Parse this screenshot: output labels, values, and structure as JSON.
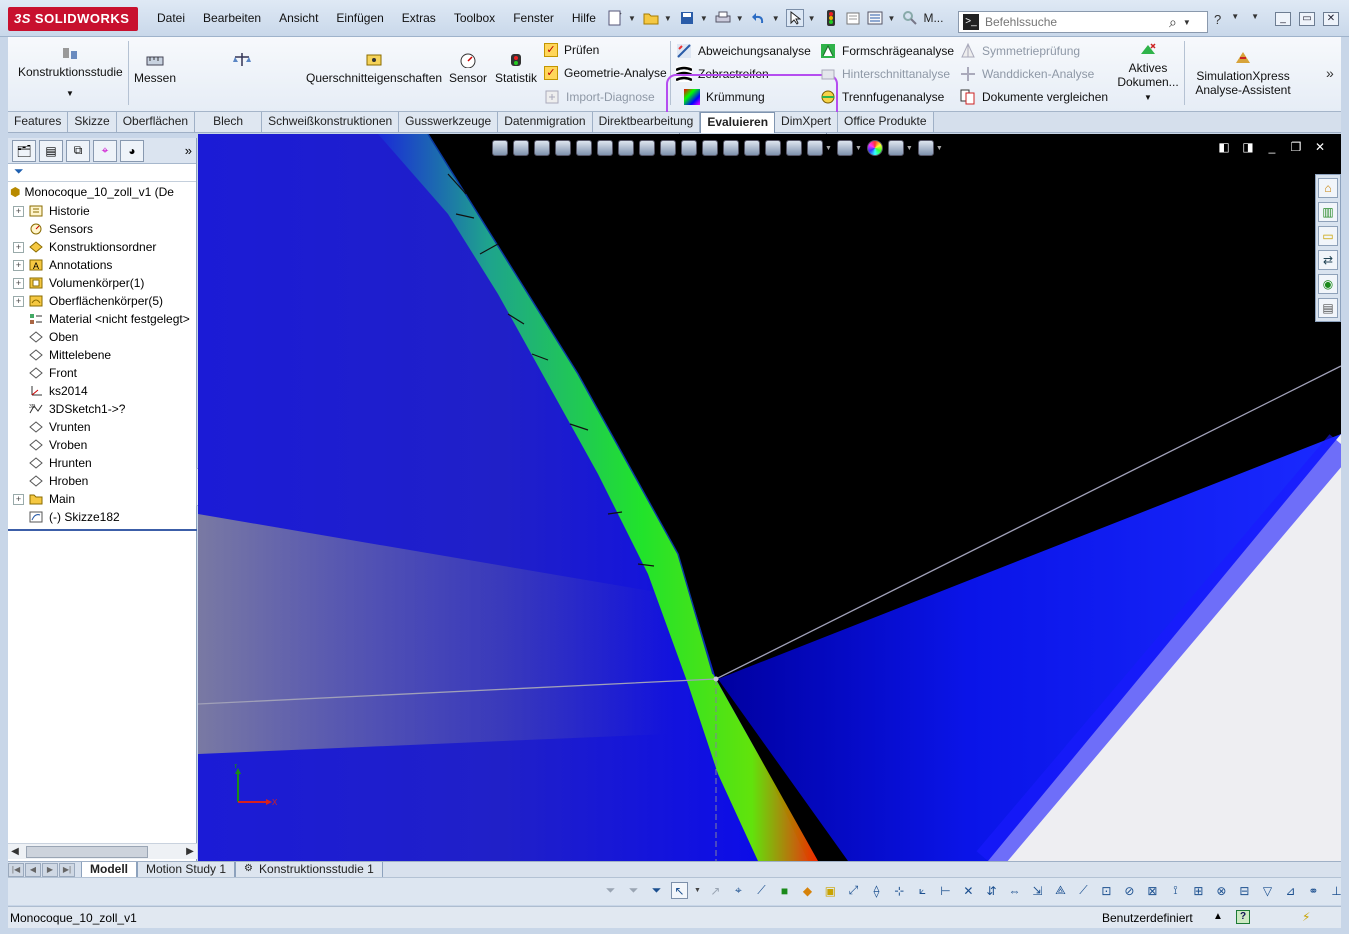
{
  "app": {
    "brand": "SOLIDWORKS",
    "brand_prefix": "3S"
  },
  "menu": {
    "items": [
      "Datei",
      "Bearbeiten",
      "Ansicht",
      "Einfügen",
      "Extras",
      "Toolbox",
      "Fenster",
      "Hilfe"
    ]
  },
  "quickaccess": {
    "m_label": "M..."
  },
  "search": {
    "placeholder": "Befehlssuche"
  },
  "ribbon": {
    "konstruktionsstudie": "Konstruktionsstudie",
    "messen": "Messen",
    "masseeigenschaften": "Masseneigenschaften",
    "querschnitt": "Querschnitteigenschaften",
    "sensor": "Sensor",
    "statistik": "Statistik",
    "pruefen": "Prüfen",
    "geometrie": "Geometrie-Analyse",
    "import": "Import-Diagnose",
    "abweichung": "Abweichungsanalyse",
    "zebra": "Zebrastreifen",
    "kruemmung": "Krümmung",
    "formschraege": "Formschrägeanalyse",
    "hinterschnitt": "Hinterschnittanalyse",
    "trennfugen": "Trennfugenanalyse",
    "symmetrie": "Symmetrieprüfung",
    "wanddicken": "Wanddicken-Analyse",
    "dokumente": "Dokumente vergleichen",
    "aktives_line1": "Aktives",
    "aktives_line2": "Dokumen...",
    "simxpress_line1": "SimulationXpress",
    "simxpress_line2": "Analyse-Assistent"
  },
  "tabs": {
    "items": [
      "Features",
      "Skizze",
      "Oberflächen",
      "Blech",
      "Schweißkonstruktionen",
      "Gusswerkzeuge",
      "Datenmigration",
      "Direktbearbeitung",
      "Evaluieren",
      "DimXpert",
      "Office Produkte"
    ],
    "active": "Evaluieren"
  },
  "tree": {
    "root": "Monocoque_10_zoll_v1  (De",
    "items": [
      {
        "label": "Historie",
        "icon": "history-icon",
        "expandable": true
      },
      {
        "label": "Sensors",
        "icon": "sensor-icon",
        "expandable": false
      },
      {
        "label": "Konstruktionsordner",
        "icon": "design-binder-icon",
        "expandable": true
      },
      {
        "label": "Annotations",
        "icon": "annotations-icon",
        "expandable": true
      },
      {
        "label": "Volumenkörper(1)",
        "icon": "solid-bodies-icon",
        "expandable": true
      },
      {
        "label": "Oberflächenkörper(5)",
        "icon": "surface-bodies-icon",
        "expandable": true
      },
      {
        "label": "Material <nicht festgelegt>",
        "icon": "material-icon",
        "expandable": false
      },
      {
        "label": "Oben",
        "icon": "plane-icon",
        "expandable": false
      },
      {
        "label": "Mittelebene",
        "icon": "plane-icon",
        "expandable": false
      },
      {
        "label": "Front",
        "icon": "plane-icon",
        "expandable": false
      },
      {
        "label": "ks2014",
        "icon": "coordinate-system-icon",
        "expandable": false
      },
      {
        "label": "3DSketch1->?",
        "icon": "3d-sketch-icon",
        "expandable": false
      },
      {
        "label": "Vrunten",
        "icon": "plane-icon",
        "expandable": false
      },
      {
        "label": "Vroben",
        "icon": "plane-icon",
        "expandable": false
      },
      {
        "label": "Hrunten",
        "icon": "plane-icon",
        "expandable": false
      },
      {
        "label": "Hroben",
        "icon": "plane-icon",
        "expandable": false
      },
      {
        "label": "Main",
        "icon": "folder-icon",
        "expandable": true
      },
      {
        "label": "(-) Skizze182",
        "icon": "sketch-icon",
        "expandable": false
      }
    ]
  },
  "bottom_tabs": {
    "items": [
      "Modell",
      "Motion Study 1",
      "Konstruktionsstudie 1"
    ],
    "active": "Modell"
  },
  "status": {
    "filename": "Monocoque_10_zoll_v1",
    "units": "Benutzerdefiniert"
  },
  "colors": {
    "highlight": "#b54df0",
    "brand": "#c8102e",
    "viewport_bg": "#000000"
  }
}
